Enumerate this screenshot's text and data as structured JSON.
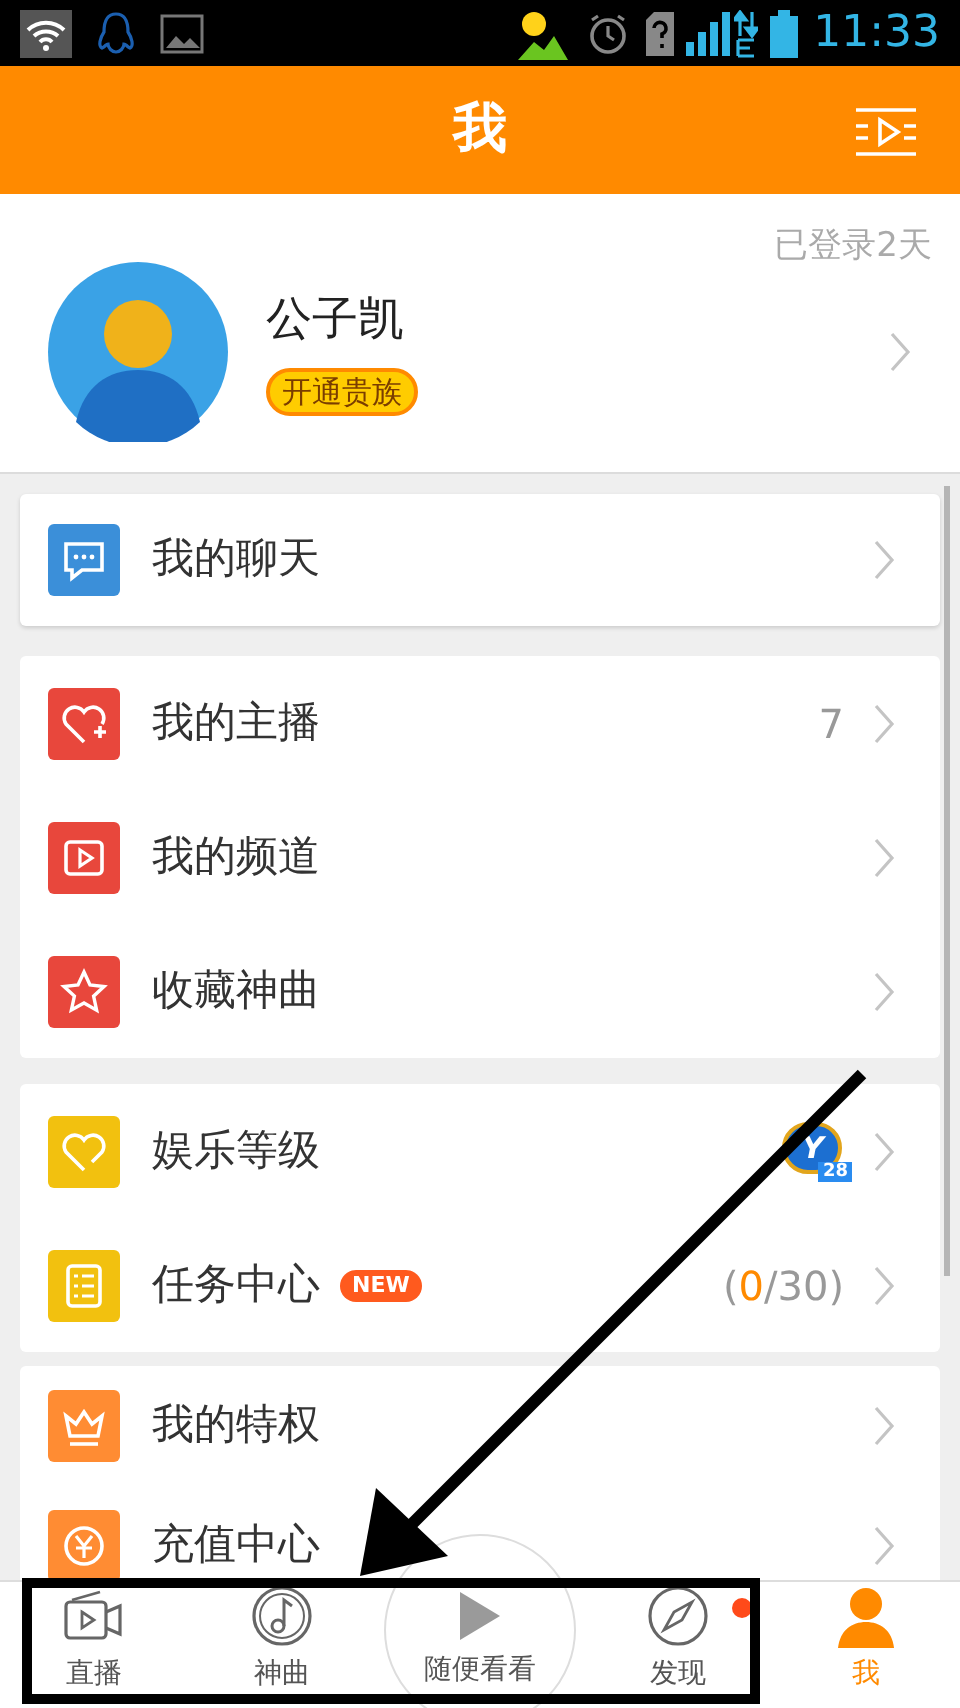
{
  "status_bar": {
    "time": "11:33"
  },
  "header": {
    "title": "我"
  },
  "profile": {
    "login_days": "已登录2天",
    "name": "公子凯",
    "vip_button": "开通贵族"
  },
  "groups": [
    {
      "items": [
        {
          "label": "我的聊天",
          "color": "#3b8fd9"
        }
      ]
    },
    {
      "items": [
        {
          "label": "我的主播",
          "color": "#e8473c",
          "value": "7"
        },
        {
          "label": "我的频道",
          "color": "#e8473c"
        },
        {
          "label": "收藏神曲",
          "color": "#e8473c"
        }
      ]
    },
    {
      "items": [
        {
          "label": "娱乐等级",
          "color": "#f2c10f",
          "badge_letter": "Y",
          "badge_number": "28"
        },
        {
          "label": "任务中心",
          "color": "#f2c10f",
          "tag": "NEW",
          "value_prefix": "(",
          "value_highlight": "0",
          "value_suffix": "/30)"
        }
      ]
    },
    {
      "items": [
        {
          "label": "我的特权",
          "color": "#ff8c33"
        },
        {
          "label": "充值中心",
          "color": "#ff8c33"
        }
      ]
    }
  ],
  "nav": [
    {
      "label": "直播",
      "selected": false,
      "dot": false
    },
    {
      "label": "神曲",
      "selected": false,
      "dot": false
    },
    {
      "label": "随便看看",
      "selected": false,
      "dot": false,
      "kind": "center"
    },
    {
      "label": "发现",
      "selected": false,
      "dot": true
    },
    {
      "label": "我",
      "selected": true,
      "dot": false
    }
  ],
  "annotations": {
    "arrow": true,
    "frame": true
  }
}
